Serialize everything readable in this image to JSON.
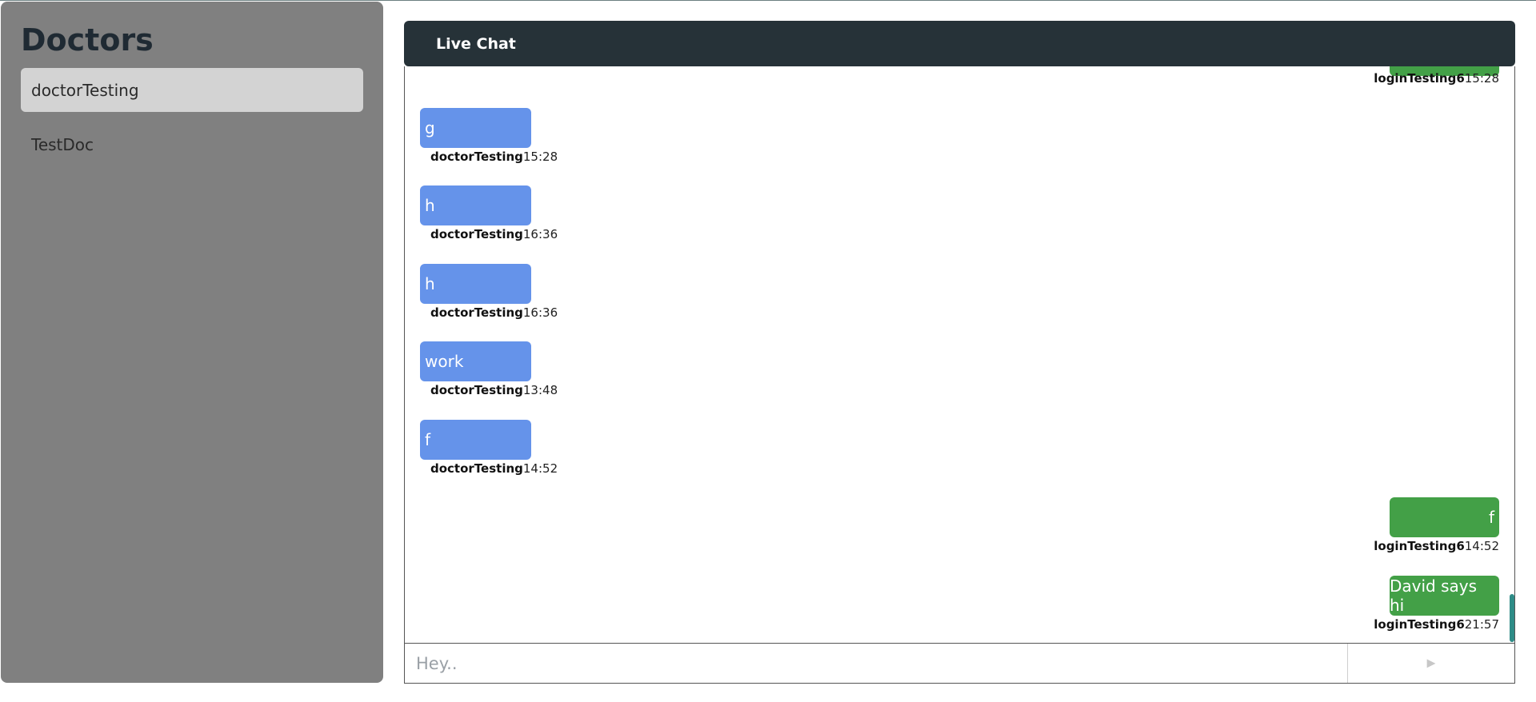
{
  "sidebar": {
    "title": "Doctors",
    "items": [
      {
        "label": "doctorTesting"
      },
      {
        "label": "TestDoc"
      }
    ]
  },
  "chat": {
    "title": "Live Chat",
    "messages": [
      {
        "text": "",
        "sender": "loginTesting6",
        "time": "15:28"
      },
      {
        "text": "g",
        "sender": "doctorTesting",
        "time": "15:28"
      },
      {
        "text": "h",
        "sender": "doctorTesting",
        "time": "16:36"
      },
      {
        "text": "h",
        "sender": "doctorTesting",
        "time": "16:36"
      },
      {
        "text": "work",
        "sender": "doctorTesting",
        "time": "13:48"
      },
      {
        "text": "f",
        "sender": "doctorTesting",
        "time": "14:52"
      },
      {
        "text": "f",
        "sender": "loginTesting6",
        "time": "14:52"
      },
      {
        "text": "David says hi",
        "sender": "loginTesting6",
        "time": "21:57"
      }
    ]
  },
  "composer": {
    "placeholder": "Hey..",
    "value": "",
    "send_icon": "send-arrow-icon"
  },
  "colors": {
    "doctor_bubble": "#6593ea",
    "patient_bubble": "#43a047",
    "header_bg": "#263238",
    "sidebar_bg": "#808080"
  }
}
